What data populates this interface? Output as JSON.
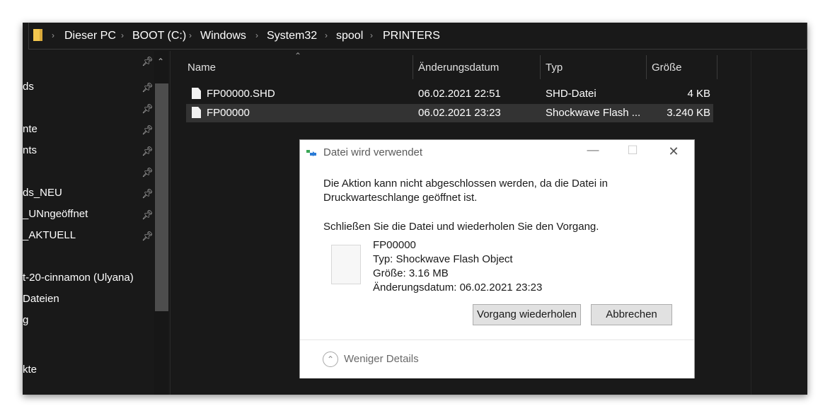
{
  "breadcrumb": [
    "Dieser PC",
    "BOOT (C:)",
    "Windows",
    "System32",
    "spool",
    "PRINTERS"
  ],
  "nav_items": [
    {
      "label": "ds",
      "pinned": true
    },
    {
      "label": "",
      "pinned": true
    },
    {
      "label": "nte",
      "pinned": true
    },
    {
      "label": "nts",
      "pinned": true
    },
    {
      "label": "",
      "pinned": true
    },
    {
      "label": "ds_NEU",
      "pinned": true
    },
    {
      "label": "_UNngeöffnet",
      "pinned": true
    },
    {
      "label": "_AKTUELL",
      "pinned": true
    },
    {
      "label": "",
      "pinned": false
    },
    {
      "label": "t-20-cinnamon (Ulyana)",
      "pinned": false
    },
    {
      "label": "Dateien",
      "pinned": false
    },
    {
      "label": "g",
      "pinned": false
    },
    {
      "label": "",
      "pinned": false
    },
    {
      "label": "kte",
      "pinned": false
    }
  ],
  "columns": {
    "name": "Name",
    "date": "Änderungsdatum",
    "type": "Typ",
    "size": "Größe"
  },
  "files": [
    {
      "name": "FP00000.SHD",
      "date": "06.02.2021 22:51",
      "type": "SHD-Datei",
      "size": "4 KB",
      "selected": false
    },
    {
      "name": "FP00000",
      "date": "06.02.2021 23:23",
      "type": "Shockwave Flash ...",
      "size": "3.240 KB",
      "selected": true
    }
  ],
  "dialog": {
    "title": "Datei wird verwendet",
    "message_line1": "Die Aktion kann nicht abgeschlossen werden, da die Datei in",
    "message_line2": "Druckwarteschlange geöffnet ist.",
    "instruction": "Schließen Sie die Datei und wiederholen Sie den Vorgang.",
    "file_name": "FP00000",
    "file_type": "Typ: Shockwave Flash Object",
    "file_size": "Größe: 3.16 MB",
    "file_date": "Änderungsdatum: 06.02.2021 23:23",
    "retry_button": "Vorgang wiederholen",
    "cancel_button": "Abbrechen",
    "details_toggle": "Weniger Details",
    "minimize_glyph": "—",
    "maximize_glyph": "☐",
    "close_glyph": "✕"
  },
  "colors": {
    "window_bg": "#191919",
    "selected_row": "#333333",
    "folder_icon": "#f3c74f",
    "dialog_bg": "#ffffff"
  }
}
